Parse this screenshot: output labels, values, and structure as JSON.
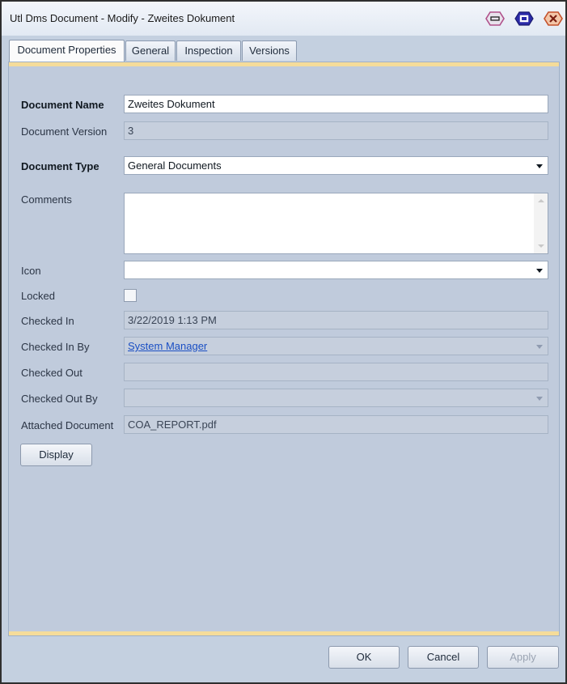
{
  "window": {
    "title": "Utl Dms Document - Modify - Zweites Dokument"
  },
  "tabs": [
    {
      "label": "Document Properties",
      "active": true
    },
    {
      "label": "General"
    },
    {
      "label": "Inspection"
    },
    {
      "label": "Versions"
    }
  ],
  "form": {
    "document_name": {
      "label": "Document Name",
      "value": "Zweites Dokument"
    },
    "document_version": {
      "label": "Document Version",
      "value": "3"
    },
    "document_type": {
      "label": "Document Type",
      "value": "General Documents"
    },
    "comments": {
      "label": "Comments",
      "value": ""
    },
    "icon": {
      "label": "Icon",
      "value": ""
    },
    "locked": {
      "label": "Locked",
      "checked": false
    },
    "checked_in": {
      "label": "Checked In",
      "value": "3/22/2019 1:13 PM"
    },
    "checked_in_by": {
      "label": "Checked In By",
      "value": "System Manager"
    },
    "checked_out": {
      "label": "Checked Out",
      "value": ""
    },
    "checked_out_by": {
      "label": "Checked Out By",
      "value": ""
    },
    "attached_document": {
      "label": "Attached Document",
      "value": "COA_REPORT.pdf"
    },
    "display_button": "Display"
  },
  "footer": {
    "ok": "OK",
    "cancel": "Cancel",
    "apply": "Apply"
  },
  "icons": {
    "minimize": "minimize-icon",
    "maximize": "maximize-icon",
    "close": "close-icon"
  },
  "colors": {
    "accent": "#f5dc9a",
    "panel": "#c0cbdc",
    "link": "#1a4fc4"
  }
}
